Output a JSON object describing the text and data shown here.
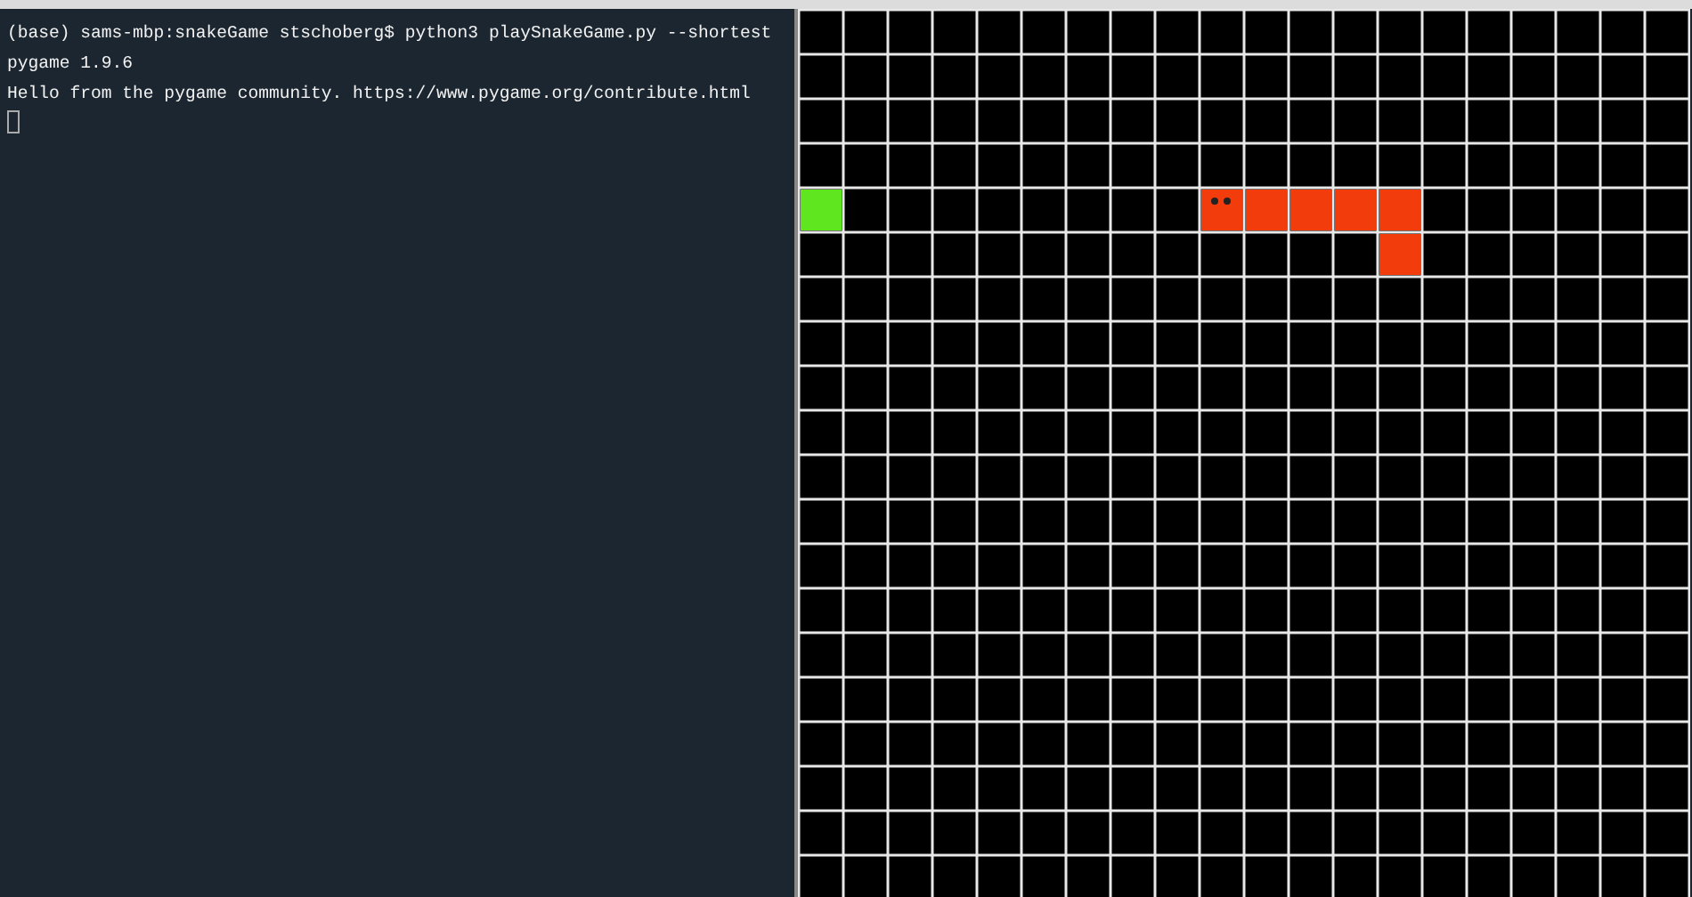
{
  "terminal": {
    "lines": [
      "(base) sams-mbp:snakeGame stschoberg$ python3 playSnakeGame.py --shortest",
      "pygame 1.9.6",
      "Hello from the pygame community. https://www.pygame.org/contribute.html"
    ],
    "cursor": true
  }
}
